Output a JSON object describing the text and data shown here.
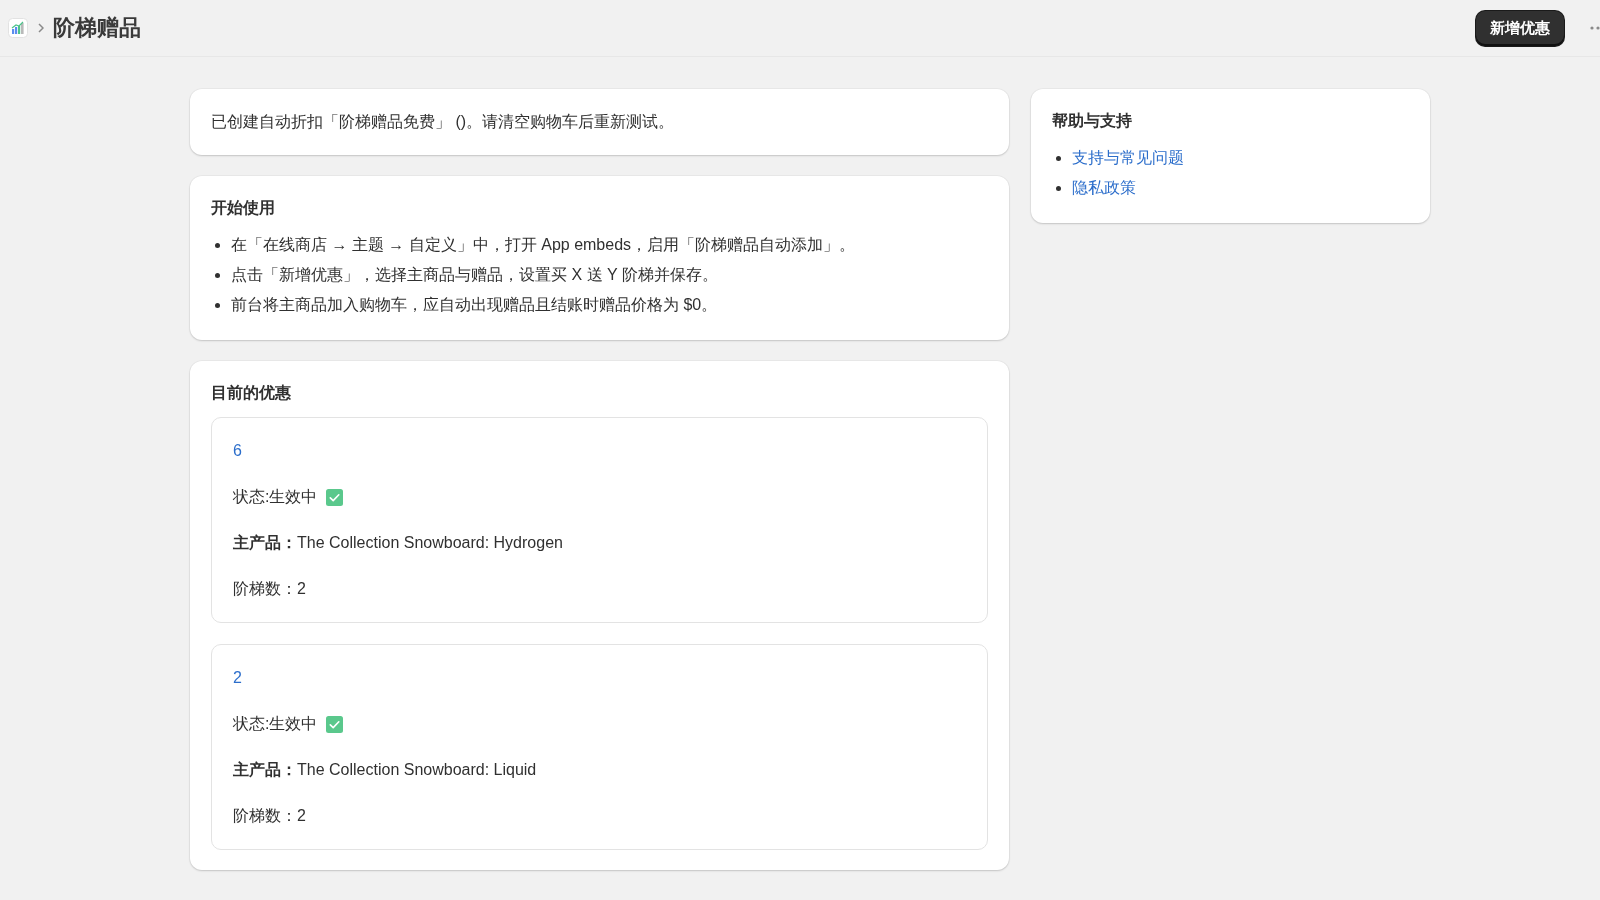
{
  "header": {
    "title": "阶梯赠品",
    "primary_button": "新增优惠"
  },
  "notice": {
    "text": "已创建自动折扣「阶梯赠品免费」 ()。请清空购物车后重新测试。"
  },
  "getting_started": {
    "title": "开始使用",
    "steps": [
      "在「在线商店 → 主题 → 自定义」中，打开 App embeds，启用「阶梯赠品自动添加」。",
      "点击「新增优惠」，选择主商品与赠品，设置买 X 送 Y 阶梯并保存。",
      "前台将主商品加入购物车，应自动出现赠品且结账时赠品价格为 $0。"
    ]
  },
  "current_offers": {
    "title": "目前的优惠",
    "offers": [
      {
        "id": "6",
        "status": "状态:生效中",
        "active": true,
        "product": "**主产品：**The Collection Snowboard: Hydrogen",
        "tiers": "阶梯数：2"
      },
      {
        "id": "2",
        "status": "状态:生效中",
        "active": true,
        "product": "**主产品：**The Collection Snowboard: Liquid",
        "tiers": "阶梯数：2"
      }
    ]
  },
  "help": {
    "title": "帮助与支持",
    "links": [
      "支持与常见问题",
      "隐私政策"
    ]
  }
}
